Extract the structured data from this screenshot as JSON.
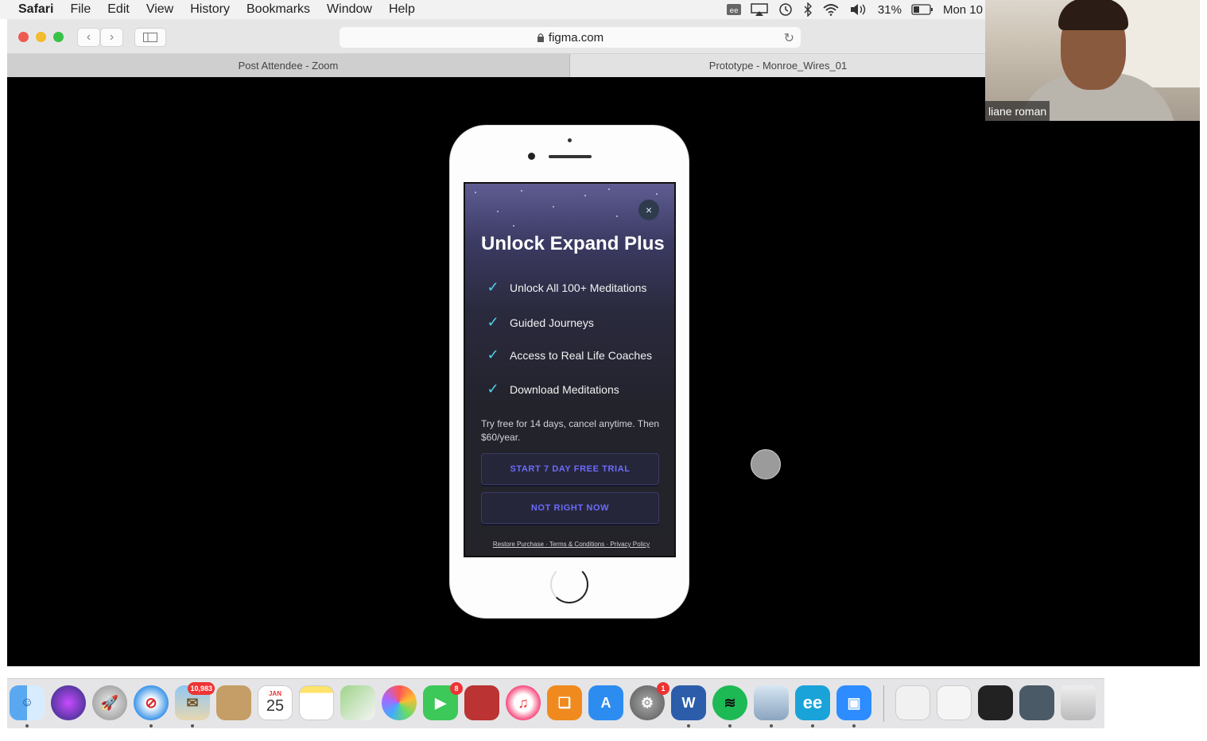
{
  "menubar": {
    "app_name": "Safari",
    "items": [
      "File",
      "Edit",
      "View",
      "History",
      "Bookmarks",
      "Window",
      "Help"
    ],
    "battery": "31%",
    "clock": "Mon 10"
  },
  "browser": {
    "url": "figma.com",
    "tabs": [
      {
        "label": "Post Attendee - Zoom",
        "active": false
      },
      {
        "label": "Prototype - Monroe_Wires_01",
        "active": true
      }
    ]
  },
  "video_tile": {
    "participant_name": "liane roman"
  },
  "prototype": {
    "title": "Unlock Expand Plus",
    "features": [
      "Unlock All 100+ Meditations",
      "Guided Journeys",
      "Access to Real Life Coaches",
      "Download Meditations"
    ],
    "trial_text": "Try free for 14 days, cancel anytime. Then $60/year.",
    "primary_button": "START 7 DAY FREE TRIAL",
    "secondary_button": "NOT RIGHT NOW",
    "footer_links": "Restore Purchase · Terms & Conditions · Privacy Policy",
    "close_icon": "×"
  },
  "dock": {
    "mail_badge": "10,983",
    "facetime_badge": "8",
    "prefs_badge": "1",
    "calendar_month": "JAN",
    "calendar_day": "25",
    "word_letter": "W",
    "ee_label": "ee"
  },
  "colors": {
    "accent_check": "#4fd0e6",
    "button_text": "#6b6bff"
  }
}
